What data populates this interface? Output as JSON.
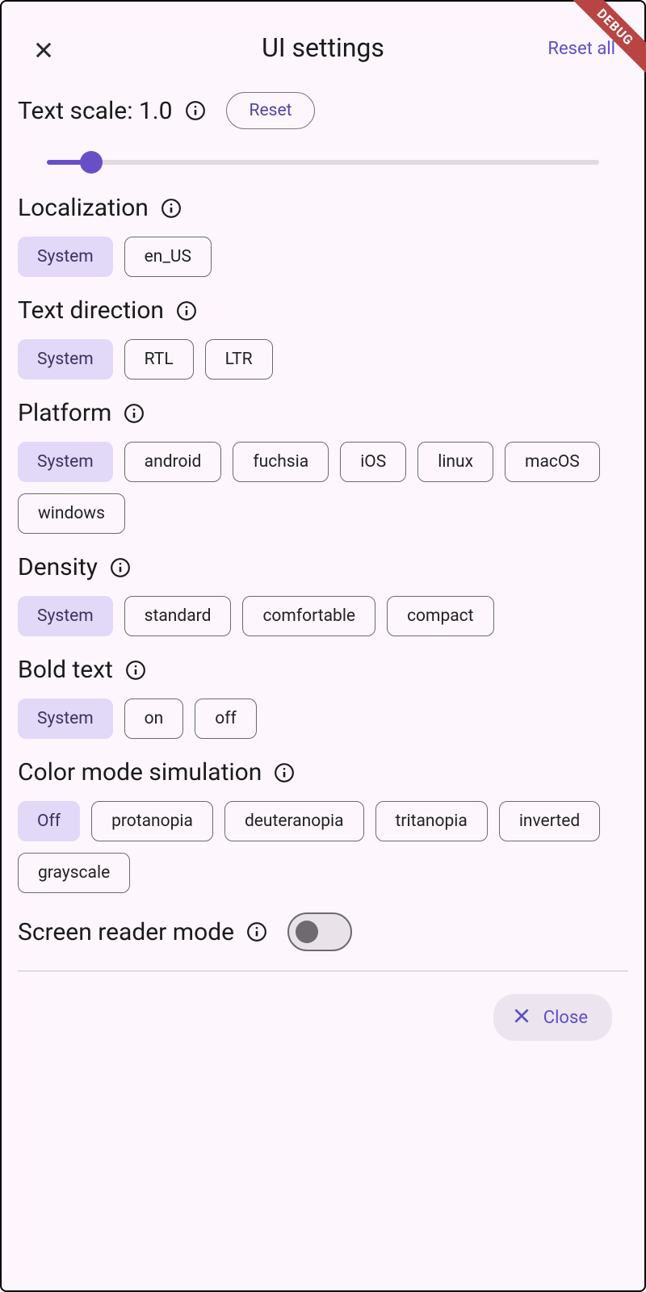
{
  "header": {
    "title": "UI settings",
    "reset_all": "Reset all"
  },
  "debug_label": "DEBUG",
  "text_scale": {
    "label": "Text scale: 1.0",
    "reset_label": "Reset",
    "value": 1.0
  },
  "localization": {
    "label": "Localization",
    "options": [
      {
        "label": "System",
        "selected": true
      },
      {
        "label": "en_US",
        "selected": false
      }
    ]
  },
  "text_direction": {
    "label": "Text direction",
    "options": [
      {
        "label": "System",
        "selected": true
      },
      {
        "label": "RTL",
        "selected": false
      },
      {
        "label": "LTR",
        "selected": false
      }
    ]
  },
  "platform": {
    "label": "Platform",
    "options": [
      {
        "label": "System",
        "selected": true
      },
      {
        "label": "android",
        "selected": false
      },
      {
        "label": "fuchsia",
        "selected": false
      },
      {
        "label": "iOS",
        "selected": false
      },
      {
        "label": "linux",
        "selected": false
      },
      {
        "label": "macOS",
        "selected": false
      },
      {
        "label": "windows",
        "selected": false
      }
    ]
  },
  "density": {
    "label": "Density",
    "options": [
      {
        "label": "System",
        "selected": true
      },
      {
        "label": "standard",
        "selected": false
      },
      {
        "label": "comfortable",
        "selected": false
      },
      {
        "label": "compact",
        "selected": false
      }
    ]
  },
  "bold_text": {
    "label": "Bold text",
    "options": [
      {
        "label": "System",
        "selected": true
      },
      {
        "label": "on",
        "selected": false
      },
      {
        "label": "off",
        "selected": false
      }
    ]
  },
  "color_mode": {
    "label": "Color mode simulation",
    "options": [
      {
        "label": "Off",
        "selected": true
      },
      {
        "label": "protanopia",
        "selected": false
      },
      {
        "label": "deuteranopia",
        "selected": false
      },
      {
        "label": "tritanopia",
        "selected": false
      },
      {
        "label": "inverted",
        "selected": false
      },
      {
        "label": "grayscale",
        "selected": false
      }
    ]
  },
  "screen_reader": {
    "label": "Screen reader mode",
    "enabled": false
  },
  "footer": {
    "close_label": "Close"
  }
}
